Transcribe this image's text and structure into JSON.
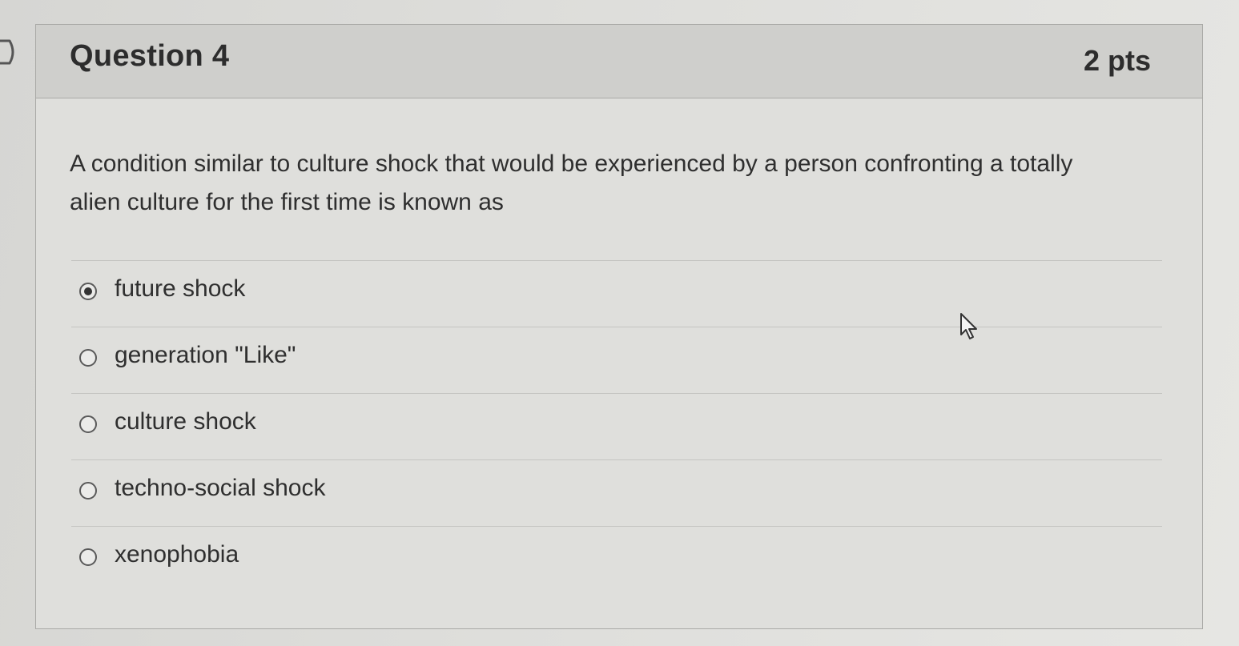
{
  "question": {
    "title": "Question 4",
    "points": "2 pts",
    "text": "A condition similar to culture shock that would be experienced by a person confronting a totally alien culture for the first time is known as"
  },
  "answers": [
    {
      "label": "future shock",
      "selected": true
    },
    {
      "label": "generation \"Like\"",
      "selected": false
    },
    {
      "label": "culture shock",
      "selected": false
    },
    {
      "label": "techno-social shock",
      "selected": false
    },
    {
      "label": "xenophobia",
      "selected": false
    }
  ],
  "icons": {
    "nav": "chevron-right-icon",
    "pointer": "mouse-cursor-icon",
    "radio_selected": "radio-selected-icon",
    "radio_unselected": "radio-unselected-icon"
  },
  "colors": {
    "background": "#d9d9d7",
    "header": "#cfcfcc",
    "text": "#2d2d2d",
    "border": "#a9a9a6"
  }
}
